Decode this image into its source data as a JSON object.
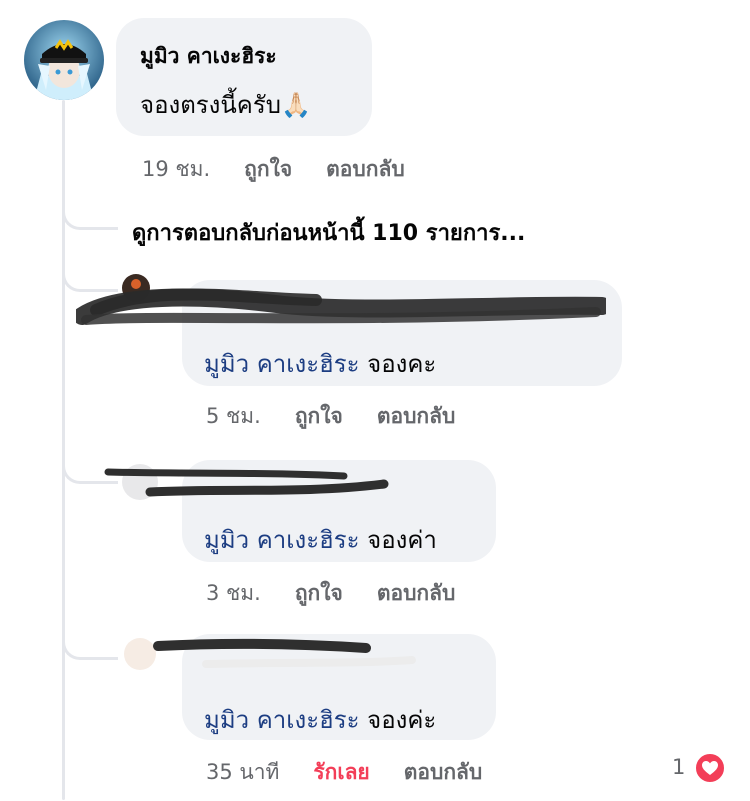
{
  "comment": {
    "author": "มูมิว คาเงะฮิระ",
    "text": "จองตรงนี้ครับ",
    "emoji": "🙏🏻",
    "time": "19 ชม.",
    "like_label": "ถูกใจ",
    "reply_label": "ตอบกลับ"
  },
  "view_more_label": "ดูการตอบกลับก่อนหน้านี้ 110 รายการ...",
  "replies": [
    {
      "mention": "มูมิว คาเงะฮิระ",
      "text": "จองคะ",
      "time": "5 ชม.",
      "like_label": "ถูกใจ",
      "reply_label": "ตอบกลับ"
    },
    {
      "mention": "มูมิว คาเงะฮิระ",
      "text": "จองค่า",
      "time": "3 ชม.",
      "like_label": "ถูกใจ",
      "reply_label": "ตอบกลับ"
    },
    {
      "mention": "มูมิว คาเงะฮิระ",
      "text": "จองค่ะ",
      "time": "35 นาที",
      "like_label": "รักเลย",
      "reply_label": "ตอบกลับ",
      "reaction_count": "1"
    }
  ],
  "colors": {
    "bubble": "#f0f2f5",
    "mention": "#1c3d82",
    "meta": "#65676b",
    "love": "#f33e58"
  }
}
